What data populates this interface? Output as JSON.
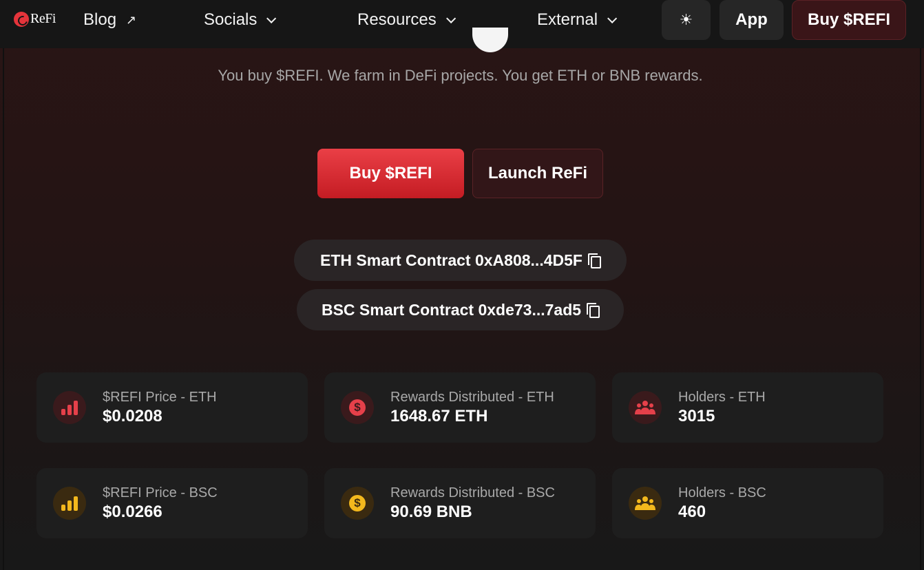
{
  "nav": {
    "logo_text": "ReFi",
    "links": [
      {
        "label": "Blog",
        "icon": "external-arrow-icon"
      },
      {
        "label": "Socials",
        "icon": "chevron-down-icon"
      },
      {
        "label": "Resources",
        "icon": "chevron-down-icon"
      },
      {
        "label": "External",
        "icon": "chevron-down-icon"
      }
    ],
    "theme_icon": "☀",
    "app_label": "App",
    "buy_label": "Buy $REFI"
  },
  "hero": {
    "tagline": "You buy $REFI. We farm in DeFi projects. You get ETH or BNB rewards.",
    "buy_label": "Buy $REFI",
    "launch_label": "Launch ReFi"
  },
  "contracts": {
    "eth": "ETH Smart Contract 0xA808...4D5F",
    "bsc": "BSC Smart Contract 0xde73...7ad5"
  },
  "stats": [
    {
      "label": "$REFI Price - ETH",
      "value": "$0.0208",
      "icon": "bar-chart-icon",
      "color": "#e5404a"
    },
    {
      "label": "Rewards Distributed - ETH",
      "value": "1648.67 ETH",
      "icon": "dollar-coin-icon",
      "color": "#e5404a"
    },
    {
      "label": "Holders - ETH",
      "value": "3015",
      "icon": "users-icon",
      "color": "#e5404a"
    },
    {
      "label": "$REFI Price - BSC",
      "value": "$0.0266",
      "icon": "bar-chart-icon",
      "color": "#f3b81d"
    },
    {
      "label": "Rewards Distributed - BSC",
      "value": "90.69 BNB",
      "icon": "dollar-coin-icon",
      "color": "#f3b81d"
    },
    {
      "label": "Holders - BSC",
      "value": "460",
      "icon": "users-icon",
      "color": "#f3b81d"
    }
  ],
  "colors": {
    "accent_red": "#e5404a",
    "accent_yellow": "#f3b81d",
    "card_bg": "#1e1e1e"
  }
}
